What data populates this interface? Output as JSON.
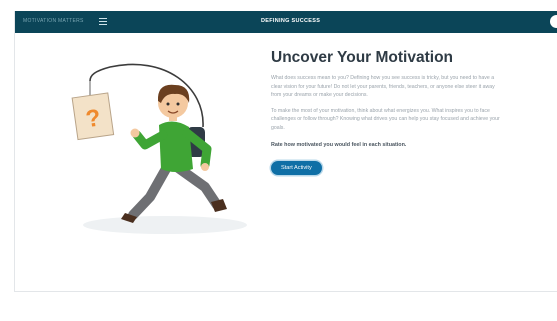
{
  "header": {
    "brand": "MOTIVATION MATTERS",
    "section_title": "DEFINING SUCCESS",
    "menu_icon": "menu-icon",
    "close_icon": "close-icon"
  },
  "illustration": {
    "sign_text": "?",
    "description_icon": "boy-chasing-question-sign"
  },
  "main": {
    "title": "Uncover Your Motivation",
    "paragraphs": [
      "What does success mean to you? Defining how you see success is tricky, but you need to have a clear vision for your future! Do not let your parents, friends, teachers, or anyone else steer it away from your dreams or make your decisions.",
      "To make the most of your motivation, think about what energizes you. What inspires you to face challenges or follow through? Knowing what drives you can help you stay focused and achieve your goals."
    ],
    "prompt": "Rate how motivated you would feel in each situation.",
    "start_button": "Start Activity"
  },
  "colors": {
    "header_bg": "#0b4558",
    "accent": "#0f6fa6",
    "shirt": "#3fa535",
    "sign": "#f3e2c8"
  }
}
